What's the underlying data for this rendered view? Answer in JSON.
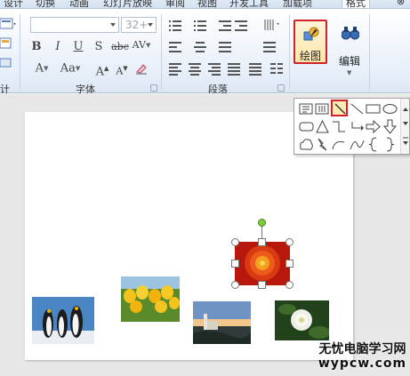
{
  "ribbon": {
    "tabs": [
      "设计",
      "切换",
      "动画",
      "幻灯片放映",
      "审阅",
      "视图",
      "开发工具",
      "加载项",
      "格式"
    ],
    "font_group_label": "字体",
    "paragraph_group_label": "段落",
    "font_size_value": "32+",
    "draw_label": "绘图",
    "edit_label": "编辑",
    "left_cut_label": "计",
    "font_buttons": {
      "bold": "B",
      "italic": "I",
      "underline": "U",
      "strike": "S",
      "abc": "abc",
      "spacing": "AV",
      "font_color": "A",
      "case": "Aa",
      "grow": "A",
      "shrink": "A"
    }
  },
  "shapes_gallery": {
    "row1": [
      "text-box-icon",
      "vertical-text-box-icon",
      "line-icon",
      "line-2-icon",
      "rectangle-icon",
      "oval-icon"
    ],
    "row2": [
      "rounded-rectangle-icon",
      "triangle-icon",
      "elbow-connector-icon",
      "elbow-arrow-icon",
      "right-arrow-icon",
      "down-arrow-icon"
    ],
    "row3": [
      "cloud-icon",
      "lightning-icon",
      "arc-icon",
      "curve-icon",
      "left-brace-icon",
      "right-brace-icon"
    ],
    "selected": "line-icon"
  },
  "slide": {
    "pictures": [
      "penguins",
      "tulips",
      "lighthouse",
      "white-flower",
      "red-chrysanthemum"
    ],
    "selected_picture": "red-chrysanthemum"
  },
  "watermark": {
    "line1": "无忧电脑学习网",
    "line2": "wypcw.com"
  },
  "colors": {
    "highlight_border": "#d0222b",
    "ribbon_bg": "#e9f0f9",
    "rotation_handle": "#7ccb3a"
  }
}
